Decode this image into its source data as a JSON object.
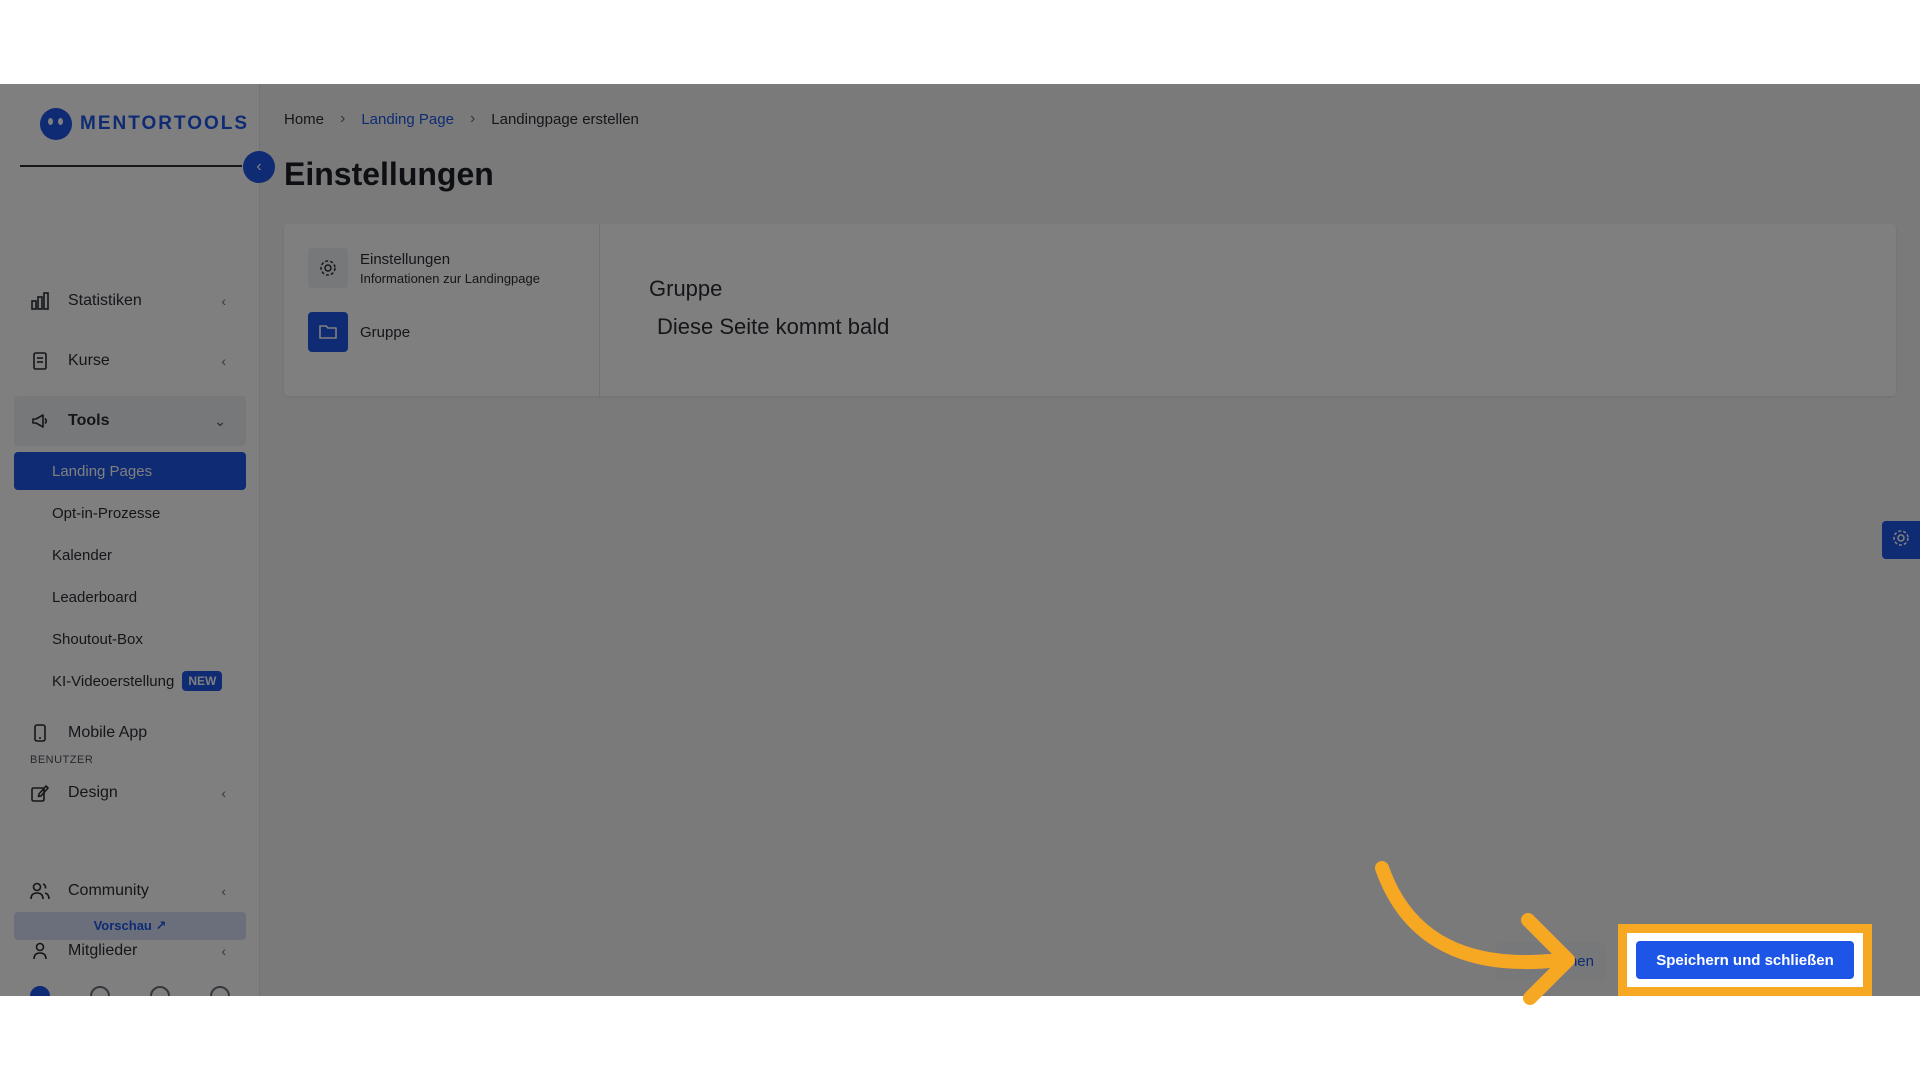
{
  "brand": {
    "name": "MENTORTOOLS"
  },
  "sidebar": {
    "items": [
      {
        "label": "Statistiken"
      },
      {
        "label": "Kurse"
      },
      {
        "label": "Tools"
      },
      {
        "label": "Mobile App"
      },
      {
        "label": "Design"
      },
      {
        "label": "Community"
      },
      {
        "label": "Mitglieder"
      }
    ],
    "tools_sub": [
      {
        "label": "Landing Pages"
      },
      {
        "label": "Opt-in-Prozesse"
      },
      {
        "label": "Kalender"
      },
      {
        "label": "Leaderboard"
      },
      {
        "label": "Shoutout-Box"
      },
      {
        "label": "KI-Videoerstellung",
        "badge": "NEW"
      }
    ],
    "section_users": "BENUTZER",
    "preview_label": "Vorschau ↗"
  },
  "breadcrumb": {
    "home": "Home",
    "parent": "Landing Page",
    "current": "Landingpage erstellen"
  },
  "page": {
    "title": "Einstellungen"
  },
  "steps": [
    {
      "title": "Einstellungen",
      "subtitle": "Informationen zur Landingpage"
    },
    {
      "title": "Gruppe"
    }
  ],
  "content": {
    "title": "Gruppe",
    "text": "Diese Seite kommt bald"
  },
  "footer": {
    "back_label_partial": "hen",
    "save_label": "Speichern und schließen"
  },
  "colors": {
    "accent": "#1d56e6",
    "highlight": "#f6a823"
  }
}
